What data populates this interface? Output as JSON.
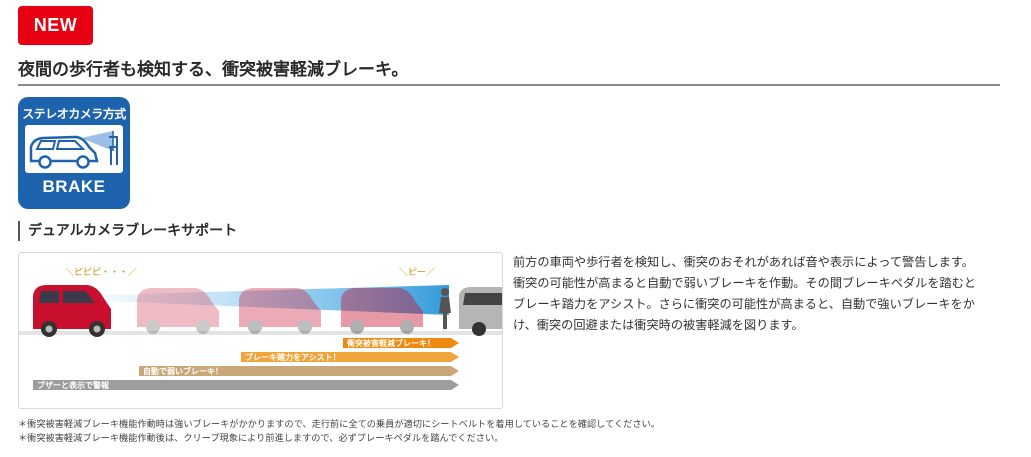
{
  "badge": {
    "label": "NEW"
  },
  "headline": "夜間の歩行者も検知する、衝突被害軽減ブレーキ。",
  "logo": {
    "title": "ステレオカメラ方式",
    "subtitle": "BRAKE"
  },
  "section": {
    "title": "デュアルカメラブレーキサポート"
  },
  "diagram": {
    "beep_early": "＼ピピピ・・・／",
    "beep_late": "＼ピー／",
    "bars": [
      {
        "label": "衝突被害軽減ブレーキ！",
        "color": "#ee8a10"
      },
      {
        "label": "ブレーキ踏力をアシスト！",
        "color": "#f0a53b"
      },
      {
        "label": "自動で弱いブレーキ！",
        "color": "#caa779"
      },
      {
        "label": "ブザーと表示で警報",
        "color": "#9d9d9d"
      }
    ]
  },
  "description": [
    "前方の車両や歩行者を検知し、衝突のおそれがあれば音や表示によって警告します。",
    "衝突の可能性が高まると自動で弱いブレーキを作動。その間ブレーキペダルを踏むと",
    "ブレーキ踏力をアシスト。さらに衝突の可能性が高まると、自動で強いブレーキをか",
    "け、衝突の回避または衝突時の被害軽減を図ります。"
  ],
  "notes": [
    "＊衝突被害軽減ブレーキ機能作動時は強いブレーキがかかりますので、走行前に全ての乗員が適切にシートベルトを着用していることを確認してください。",
    "＊衝突被害軽減ブレーキ機能作動後は、クリープ現象により前進しますので、必ずブレーキペダルを踏んでください。"
  ],
  "colors": {
    "brand_red": "#e60012",
    "logo_blue": "#1e63ad",
    "car_red": "#c8102e"
  }
}
